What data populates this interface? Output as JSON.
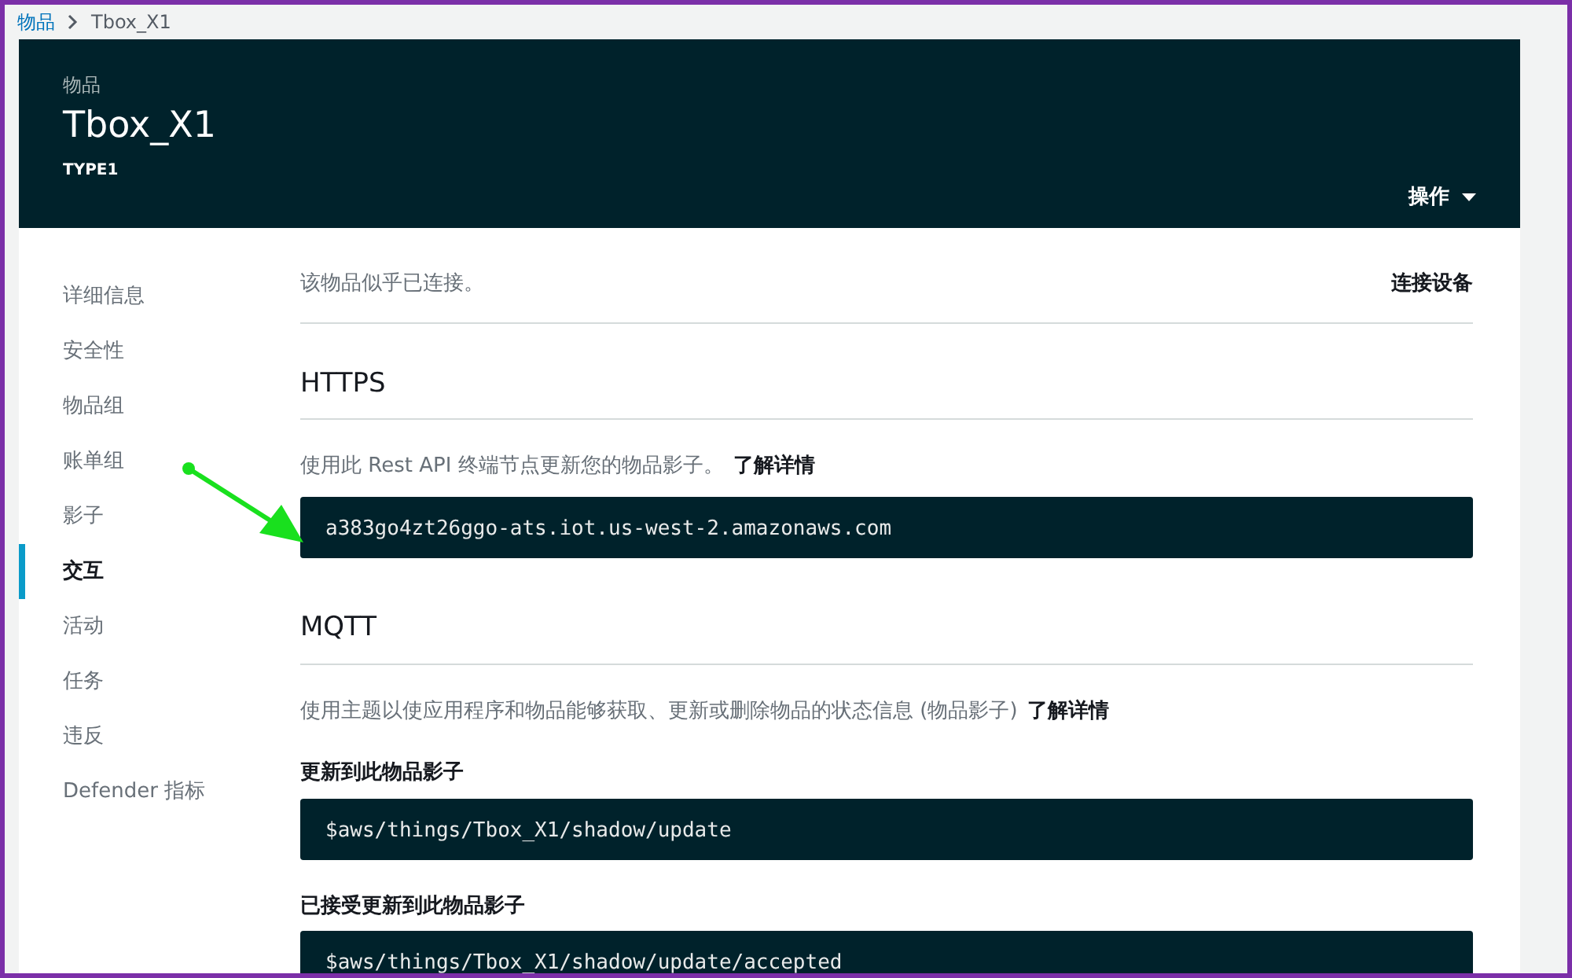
{
  "breadcrumb": [
    {
      "label": "物品",
      "kind": "link"
    },
    {
      "label": "Tbox_X1",
      "kind": "current"
    }
  ],
  "header": {
    "label": "物品",
    "title": "Tbox_X1",
    "type": "TYPE1",
    "actions_button": "操作"
  },
  "sidebar": {
    "items": [
      {
        "label": "详细信息",
        "selected": false
      },
      {
        "label": "安全性",
        "selected": false
      },
      {
        "label": "物品组",
        "selected": false
      },
      {
        "label": "账单组",
        "selected": false
      },
      {
        "label": "影子",
        "selected": false
      },
      {
        "label": "交互",
        "selected": true
      },
      {
        "label": "活动",
        "selected": false
      },
      {
        "label": "任务",
        "selected": false
      },
      {
        "label": "违反",
        "selected": false
      },
      {
        "label": "Defender 指标",
        "selected": false
      }
    ]
  },
  "status": {
    "text": "该物品似乎已连接。",
    "connect_button": "连接设备"
  },
  "https": {
    "title": "HTTPS",
    "description": "使用此 Rest API 终端节点更新您的物品影子。",
    "link": "了解详情",
    "endpoint": "a383go4zt26ggo-ats.iot.us-west-2.amazonaws.com"
  },
  "mqtt": {
    "title": "MQTT",
    "description": "使用主题以使应用程序和物品能够获取、更新或删除物品的状态信息 (物品影子)",
    "link": "了解详情",
    "topics": [
      {
        "label": "更新到此物品影子",
        "value": "$aws/things/Tbox_X1/shadow/update"
      },
      {
        "label": "已接受更新到此物品影子",
        "value": "$aws/things/Tbox_X1/shadow/update/accepted"
      }
    ]
  }
}
